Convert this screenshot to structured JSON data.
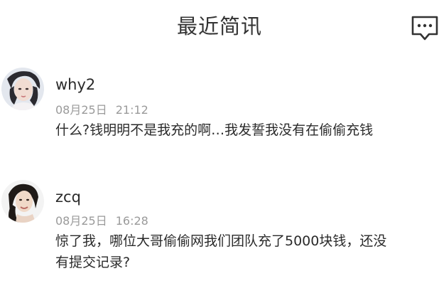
{
  "header": {
    "title": "最近简讯",
    "message_icon": "message-dots-icon"
  },
  "messages": [
    {
      "username": "why2",
      "date": "08月25日",
      "time": "21:12",
      "text": "什么?钱明明不是我充的啊…我发誓我没有在偷偷充钱",
      "avatar": "user-avatar-why2"
    },
    {
      "username": "zcq",
      "date": "08月25日",
      "time": "16:28",
      "text_line1": "惊了我，哪位大哥偷偷网我们团队充了5000块钱，还没",
      "text_line2": "有提交记录?",
      "avatar": "user-avatar-zcq"
    }
  ]
}
